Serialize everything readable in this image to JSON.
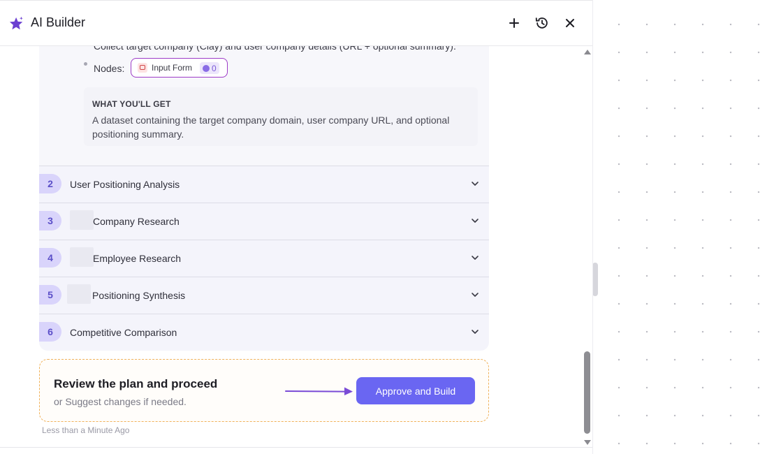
{
  "header": {
    "title": "AI Builder",
    "add_icon": "plus-icon",
    "history_icon": "history-icon",
    "close_icon": "close-icon"
  },
  "step1": {
    "cut_text": "Collect target company (Clay) and user company details (URL + optional summary).",
    "nodes_label": "Nodes:",
    "node": {
      "label": "Input Form",
      "count": "0"
    },
    "get_heading": "WHAT YOU'LL GET",
    "get_description": "A dataset containing the target company domain, user company URL, and optional positioning summary."
  },
  "steps": [
    {
      "num": "2",
      "label": "User Positioning Analysis"
    },
    {
      "num": "3",
      "label": "Company Research"
    },
    {
      "num": "4",
      "label": "Employee Research"
    },
    {
      "num": "5",
      "label": "Positioning Synthesis"
    },
    {
      "num": "6",
      "label": "Competitive Comparison"
    }
  ],
  "review": {
    "title": "Review the plan and proceed",
    "subtitle": "or Suggest changes if needed.",
    "button": "Approve and Build"
  },
  "timestamp": "Less than a Minute Ago",
  "colors": {
    "accent": "#6a66f2",
    "step_badge": "#d9d4fb",
    "review_border": "#f0b25a",
    "node_border": "#9d3bc7"
  }
}
